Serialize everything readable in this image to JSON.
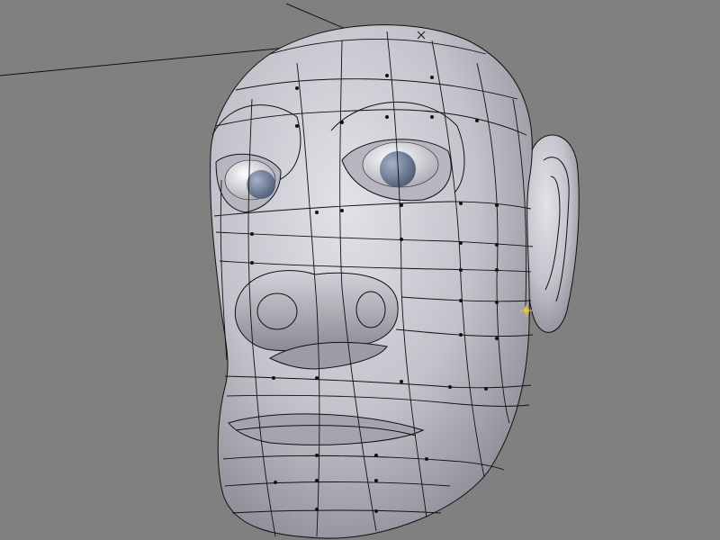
{
  "viewport": {
    "background_color": "#808080",
    "mesh_shade_light": "#d8d8de",
    "mesh_shade_mid": "#b5b5bf",
    "mesh_shade_dark": "#7a7a84",
    "wire_color": "#111111",
    "eye_iris_color": "#6f7f98",
    "selected_vertex_color": "#f2c230",
    "cursor_icon": "crosshair-icon",
    "object": "head-mesh"
  }
}
